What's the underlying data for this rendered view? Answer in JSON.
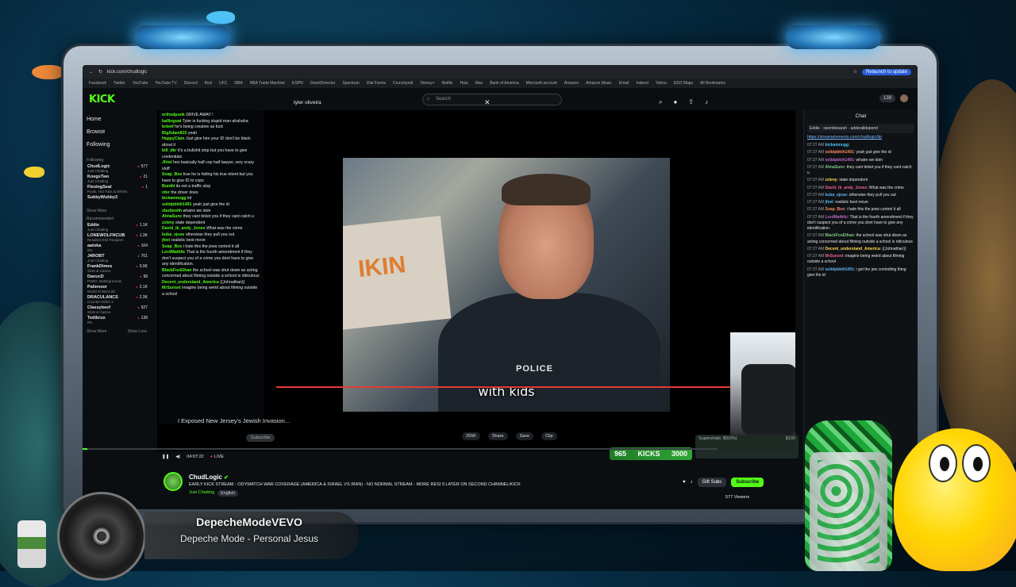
{
  "browser": {
    "url": "kick.com/chudlogic",
    "relaunch_label": "Relaunch to update",
    "bookmarks": [
      "Facebook",
      "Twitter",
      "YouTube",
      "YouTube TV",
      "Discord",
      "Kick",
      "UFC",
      "NBA",
      "NBA Trade Machine",
      "ESPN",
      "DownDetector",
      "Spectrum",
      "Dial Farms",
      "Crunchyroll",
      "Disney+",
      "Netflix",
      "Hulu",
      "Max",
      "Bank of America",
      "Microsoft account",
      "Amazon",
      "Amazon Music",
      "Email",
      "Indeed",
      "Yahoo",
      "ESO Maps",
      "All Bookmarks"
    ]
  },
  "kick": {
    "logo": "KICK",
    "search_placeholder": "Search",
    "points": "139"
  },
  "sidebar": {
    "nav": [
      "Home",
      "Browse",
      "Following"
    ],
    "section_following": "Following",
    "following": [
      {
        "name": "ChudLogic",
        "category": "Just Chatting",
        "viewers": "577"
      },
      {
        "name": "KoegsTwo",
        "category": "Just Chatting",
        "viewers": "21"
      },
      {
        "name": "FlexingSeal",
        "category": "Pools, Hot Tubs & Bikinis",
        "viewers": "1"
      },
      {
        "name": "SubbyWubby3",
        "category": "",
        "viewers": ""
      }
    ],
    "show_more_1": "Show More",
    "section_recommended": "Recommended",
    "recommended": [
      {
        "name": "Eddie",
        "category": "Just Chatting",
        "viewers": "1.1K"
      },
      {
        "name": "LONEWOLFNCUB",
        "category": "Resident Evil Requiem",
        "viewers": "1.3K"
      },
      {
        "name": "aatoka",
        "category": "IRL",
        "viewers": "104"
      },
      {
        "name": "J4ROBT",
        "category": "Just Chatting",
        "viewers": "701"
      },
      {
        "name": "FrankDimes",
        "category": "Slots & Casino",
        "viewers": "9.9K"
      },
      {
        "name": "DanucD",
        "category": "PUBG: Battlegrounds",
        "viewers": "98"
      },
      {
        "name": "Palienoor",
        "category": "World of Warcraft",
        "viewers": "2.1K"
      },
      {
        "name": "DRACULANCS",
        "category": "Counter-Strike 2",
        "viewers": "2.3K"
      },
      {
        "name": "Classybeef",
        "category": "Slots & Casino",
        "viewers": "927"
      },
      {
        "name": "Tedibrux",
        "category": "IRL",
        "viewers": "138"
      }
    ],
    "show_more_2": "Show More",
    "show_less": "Show Less"
  },
  "overlay_chat": [
    {
      "user": "orthodpunk",
      "text": "DRIVE AWAY !"
    },
    {
      "user": "ballingoat",
      "text": "Tyler is fucking stupid man ahahaha"
    },
    {
      "user": "brbmf",
      "text": "he's being creative as fuck"
    },
    {
      "user": "BigAdam815",
      "text": "yeah"
    },
    {
      "user": "HappyClam",
      "text": "Just give him your ID don't be black about it"
    },
    {
      "user": "bill_dkr",
      "text": "It's a bullshit stop but you have to give credentials"
    },
    {
      "user": "Jfriol",
      "text": "hes basically half cop half lawyer, very scary stuff"
    },
    {
      "user": "Soap_Box",
      "text": "true he is hiding his true intent but you have to give ID to cops"
    },
    {
      "user": "Bunthl",
      "text": "its not a traffic stop"
    },
    {
      "user": "nfer",
      "text": "the driver does"
    },
    {
      "user": "bickamnugg",
      "text": "lol"
    },
    {
      "user": "solidpbkih1491",
      "text": "yeah just give the id"
    },
    {
      "user": "xbutbrwth",
      "text": "whatre we doin"
    },
    {
      "user": "AlmaSunc",
      "text": "they cant ticket you if they cant catch u"
    },
    {
      "user": "zzleny",
      "text": "state dependent"
    },
    {
      "user": "David_tk_andy_Jones",
      "text": "What was the crime"
    },
    {
      "user": "kuba_sjose",
      "text": "otherwise they pull you out"
    },
    {
      "user": "jfeel",
      "text": "realistic best move"
    },
    {
      "user": "Soap_Box",
      "text": "i hate this the jews control it all"
    },
    {
      "user": "LordMathlic",
      "text": "That is the fourth amendment if they don't suspect you of a crime you dont have to give any identification."
    },
    {
      "user": "BlackFoxEthan",
      "text": "the school was shut down as acting concerned about filming outside a school is ridiculous"
    },
    {
      "user": "Decent_understand_America",
      "text": "((Johnathan))"
    },
    {
      "user": "MrSunset",
      "text": "imagine being weird about filming outside a school"
    }
  ],
  "video": {
    "search_text": "tyler oliveira",
    "caption": "with kids",
    "sign_text": "IKIN",
    "badge_text": "POLICE",
    "inner_title": "I Exposed New Jersey's Jewish Invasion...",
    "subscribe": "Subscribe",
    "likes": "255K",
    "share": "Share",
    "save": "Save",
    "clip": "Clip",
    "time": "04:07:22",
    "live": "LIVE",
    "kicks_label": "KICKS",
    "kicks_value": "3000",
    "kicks_count": "965",
    "superchats_label": "Superchats: $0(0%)",
    "superchats_goal": "$100",
    "progress": 0.008
  },
  "stream": {
    "streamer": "ChudLogic",
    "title": "EARLY KICK STREAM - ODYWATCH WAR COVERAGE (AMERICA & ISRAEL VS IRAN) - NO NORMAL STREAM - MORE RESI 9 LATER ON SECOND CHANNEL/KICK",
    "category": "Just Chatting",
    "tag": "English",
    "gift_subs": "Gift Subs",
    "subscribe": "Subscribe",
    "viewers": "577 Viewers"
  },
  "chat": {
    "header": "Chat",
    "pinned_user": "Eddie",
    "pinned_user2": "swordiesarah",
    "pinned_user3": "adderalldepend",
    "link": "https://streamelements.com/chudlogic/tip",
    "messages": [
      {
        "time": "07:27 AM",
        "user": "bickamnugg",
        "text": ""
      },
      {
        "time": "07:27 AM",
        "user": "solidpbkih1491",
        "text": "yeah just give the id"
      },
      {
        "time": "07:27 AM",
        "user": "solidpbkih1491",
        "text": "whatre we doin"
      },
      {
        "time": "07:27 AM",
        "user": "AlmaSunc",
        "text": "they cant ticket you if they cant catch u"
      },
      {
        "time": "07:27 AM",
        "user": "zzleny",
        "text": "state dependent"
      },
      {
        "time": "07:27 AM",
        "user": "David_tk_andy_Jones",
        "text": "What was the crime"
      },
      {
        "time": "07:27 AM",
        "user": "kuba_sjose",
        "text": "otherwise they pull you out"
      },
      {
        "time": "07:27 AM",
        "user": "jfeel",
        "text": "realistic best move"
      },
      {
        "time": "07:27 AM",
        "user": "Soap_Box",
        "text": "i hate this the jews control it all"
      },
      {
        "time": "07:27 AM",
        "user": "LordMathlic",
        "text": "That is the fourth amendment if they don't suspect you of a crime you dont have to give any identification."
      },
      {
        "time": "07:27 AM",
        "user": "BlackFoxEthan",
        "text": "the school was shut down as acting concerned about filming outside a school is ridiculous"
      },
      {
        "time": "07:27 AM",
        "user": "Decent_understand_America",
        "text": "((Johnathan))"
      },
      {
        "time": "07:27 AM",
        "user": "MrSunset",
        "text": "imagine being weird about filming outside a school"
      },
      {
        "time": "07:27 AM",
        "user": "solidpbkih1491",
        "text": "i get the jew controlling thing give the id"
      }
    ]
  },
  "music": {
    "artist": "DepecheModeVEVO",
    "song": "Depeche Mode - Personal Jesus"
  },
  "colors": {
    "accent": "#53fc18",
    "live_red": "#e53935",
    "link": "#7ab8ff"
  }
}
